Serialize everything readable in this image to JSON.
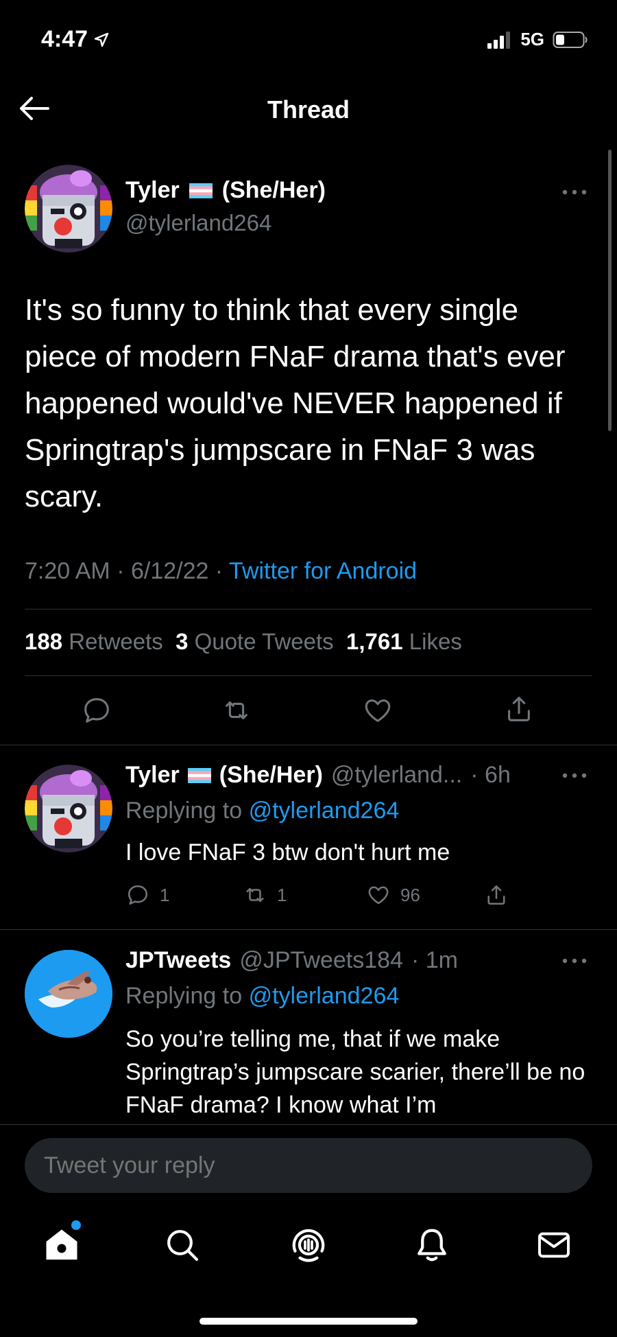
{
  "status_bar": {
    "time": "4:47",
    "network": "5G",
    "icons": [
      "location-arrow-icon",
      "signal-icon",
      "battery-icon"
    ]
  },
  "header": {
    "title": "Thread",
    "back_icon": "back-arrow-icon"
  },
  "main_tweet": {
    "display_name": "Tyler",
    "pronouns": "(She/Her)",
    "handle": "@tylerland264",
    "text": "It's so funny to think that every single piece of modern FNaF drama that's ever happened would've NEVER happened if Springtrap's jumpscare in FNaF 3 was scary.",
    "time": "7:20 AM",
    "date": "6/12/22",
    "source": "Twitter for Android",
    "stats": {
      "retweets_count": "188",
      "retweets_label": "Retweets",
      "quotes_count": "3",
      "quotes_label": "Quote Tweets",
      "likes_count": "1,761",
      "likes_label": "Likes"
    }
  },
  "replies": [
    {
      "display_name": "Tyler",
      "pronouns": "(She/Her)",
      "handle": "@tylerland...",
      "time": "· 6h",
      "replying_prefix": "Replying to",
      "replying_to": "@tylerland264",
      "text": "I love FNaF 3 btw don't hurt me",
      "reply_count": "1",
      "retweet_count": "1",
      "like_count": "96"
    },
    {
      "display_name": "JPTweets",
      "handle": "@JPTweets184",
      "time": "· 1m",
      "replying_prefix": "Replying to",
      "replying_to": "@tylerland264",
      "text": "So you’re telling me, that if we make Springtrap’s jumpscare scarier, there’ll be no FNaF drama? I know what I’m"
    }
  ],
  "compose": {
    "placeholder": "Tweet your reply"
  },
  "colors": {
    "background": "#000000",
    "accent": "#1d9bf0",
    "muted_text": "#71767b",
    "divider": "#2f3336"
  }
}
